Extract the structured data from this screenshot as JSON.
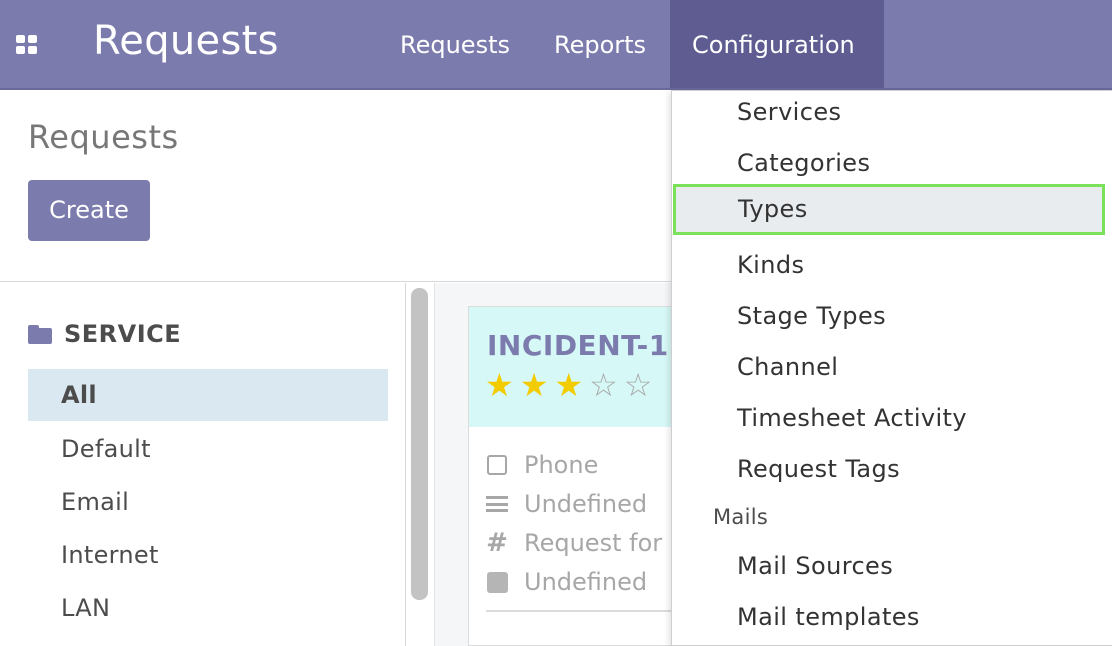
{
  "app": {
    "title": "Requests"
  },
  "topnav": {
    "items": [
      {
        "label": "Requests"
      },
      {
        "label": "Reports"
      },
      {
        "label": "Configuration"
      }
    ]
  },
  "control_panel": {
    "title": "Requests",
    "create_label": "Create"
  },
  "sidebar": {
    "header": "SERVICE",
    "header_icon": "folder-icon",
    "items": [
      {
        "label": "All",
        "active": true
      },
      {
        "label": "Default"
      },
      {
        "label": "Email"
      },
      {
        "label": "Internet"
      },
      {
        "label": "LAN"
      }
    ]
  },
  "card": {
    "name": "INCIDENT-1",
    "rating": {
      "value": 3,
      "max": 5
    },
    "rows": [
      {
        "icon": "checkbox-icon",
        "text": "Phone"
      },
      {
        "icon": "list-icon",
        "text": "Undefined"
      },
      {
        "icon": "hash-icon",
        "text": "Request for"
      },
      {
        "icon": "square-icon",
        "text": "Undefined"
      }
    ]
  },
  "config_menu": {
    "items": [
      {
        "label": "Services"
      },
      {
        "label": "Categories"
      },
      {
        "label": "Types",
        "highlighted": true
      },
      {
        "label": "Kinds"
      },
      {
        "label": "Stage Types"
      },
      {
        "label": "Channel"
      },
      {
        "label": "Timesheet Activity"
      },
      {
        "label": "Request Tags"
      }
    ],
    "mails_header": "Mails",
    "mail_items": [
      {
        "label": "Mail Sources"
      },
      {
        "label": "Mail templates"
      }
    ]
  },
  "colors": {
    "brand": "#7c7bad",
    "brand_dark": "#5e5c91",
    "card_header": "#d6f8f6",
    "active_item": "#d9e8f1",
    "star_on": "#f3cc00",
    "highlight_border": "#7be15a"
  }
}
